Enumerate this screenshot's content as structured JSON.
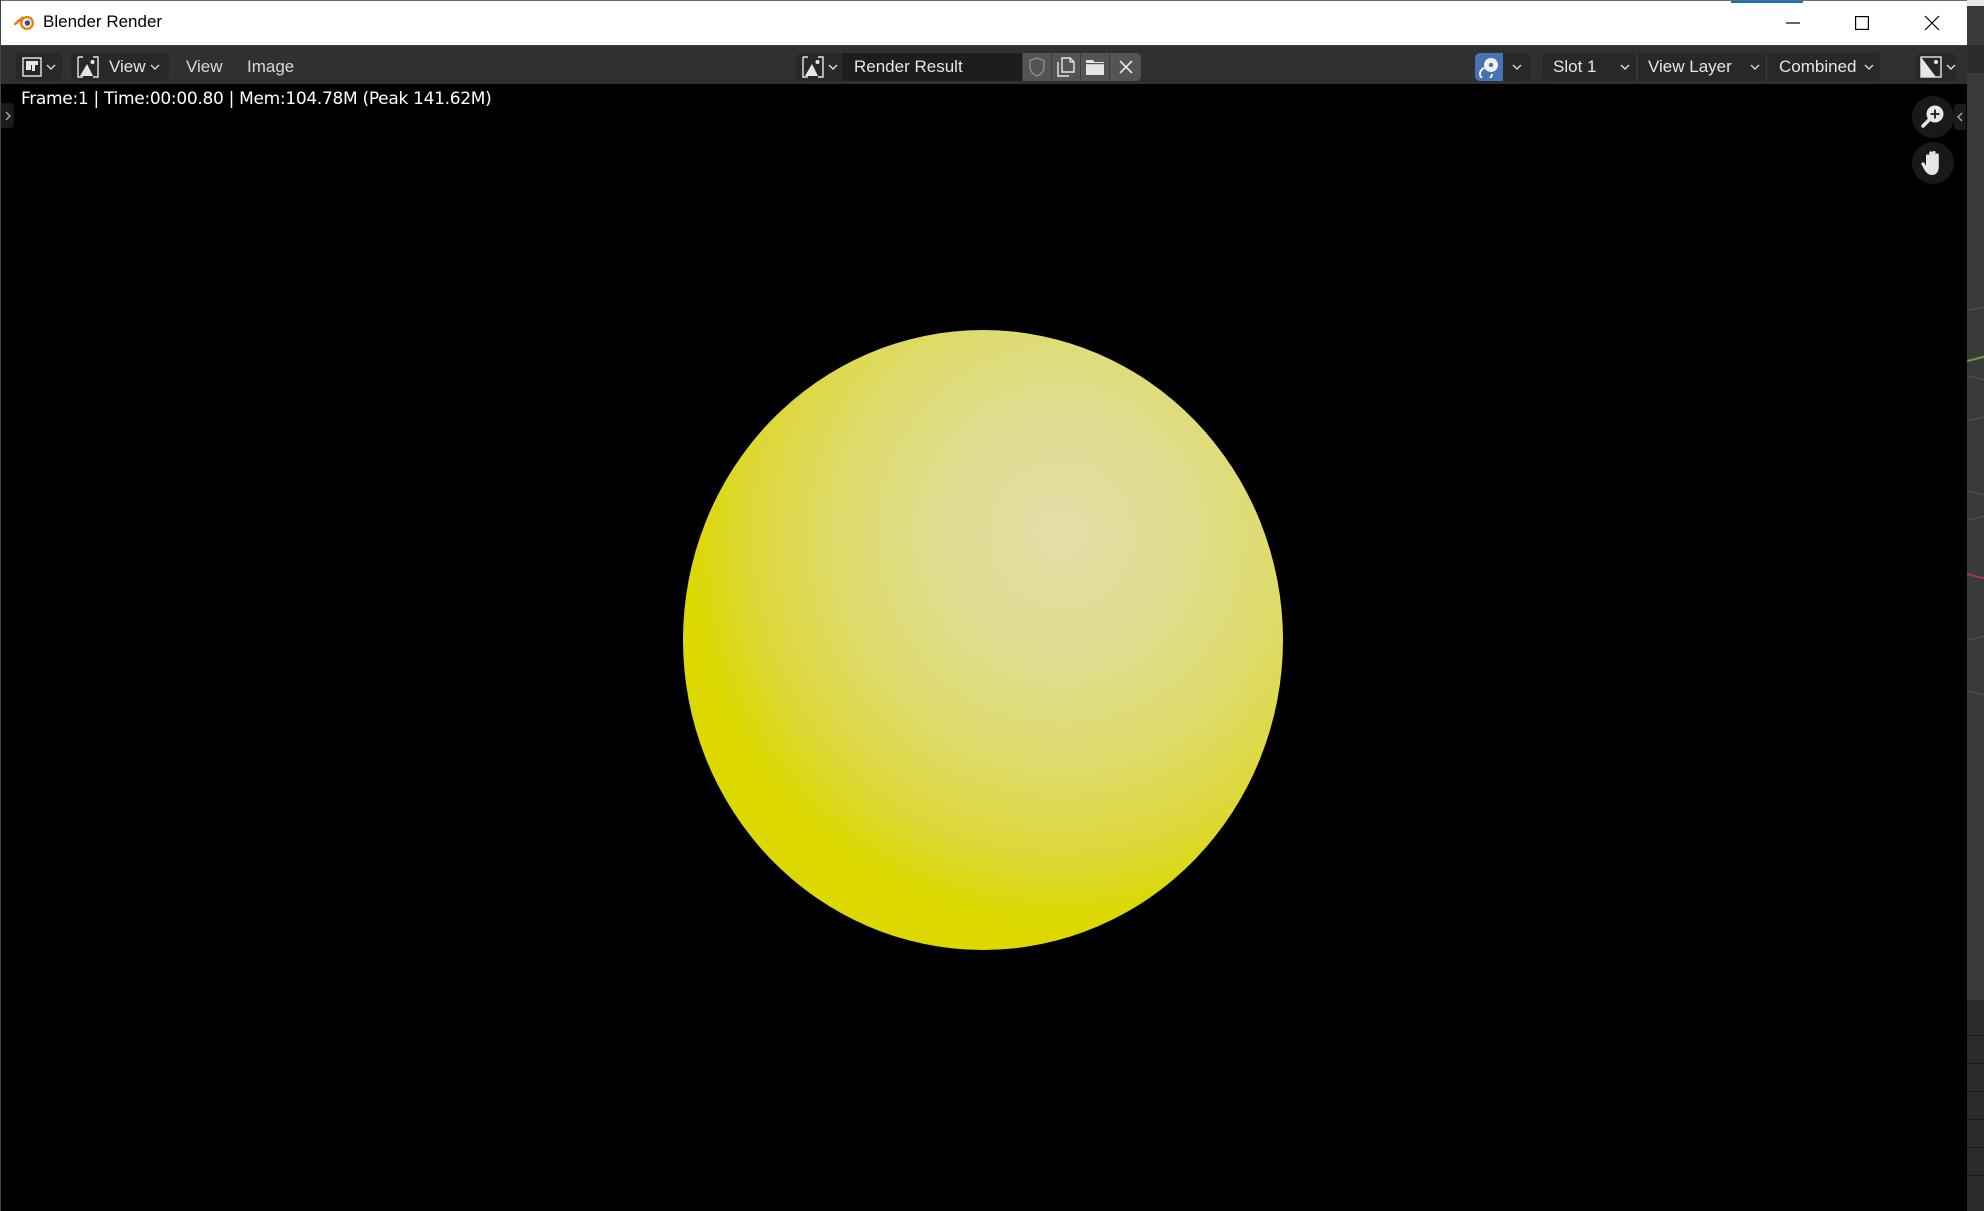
{
  "window": {
    "title": "Blender Render",
    "controls": {
      "minimize": "minimize",
      "maximize": "maximize",
      "close": "close"
    }
  },
  "header": {
    "editor_type_icon": "image-editor-icon",
    "view_mode_dropdown": {
      "icon": "image-icon",
      "label": "View"
    },
    "menus": [
      {
        "label": "View"
      },
      {
        "label": "Image"
      }
    ],
    "image_selector": {
      "icon": "image-browse-icon",
      "name": "Render Result",
      "actions": [
        {
          "name": "fake-user",
          "icon": "shield-icon"
        },
        {
          "name": "new-image",
          "icon": "duplicate-icon"
        },
        {
          "name": "open-image",
          "icon": "folder-icon"
        },
        {
          "name": "unlink-image",
          "icon": "close-icon"
        }
      ]
    },
    "render_slot_toggle": {
      "icon": "render-slot-icon",
      "active": true
    },
    "slot": "Slot 1",
    "view_layer": "View Layer",
    "pass": "Combined",
    "display_channels_icon": "display-channels-icon"
  },
  "viewport": {
    "render_info": "Frame:1 | Time:00:00.80 | Mem:104.78M (Peak 141.62M)",
    "object": "sphere",
    "colors": {
      "sphere_base": "#dcd800",
      "sphere_highlight": "#e3dfa9",
      "background": "#000000",
      "accent_blue": "#4772b3"
    }
  }
}
